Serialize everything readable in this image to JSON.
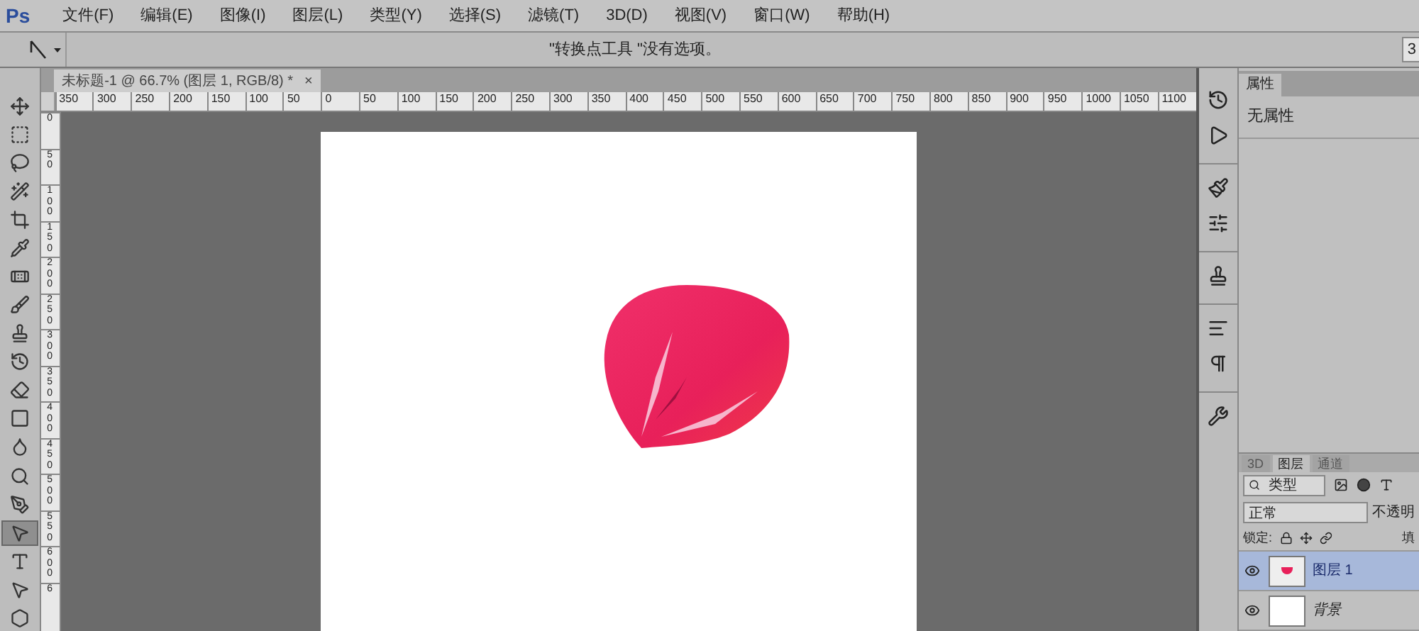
{
  "app": {
    "logo": "Ps"
  },
  "menu": [
    "文件(F)",
    "编辑(E)",
    "图像(I)",
    "图层(L)",
    "类型(Y)",
    "选择(S)",
    "滤镜(T)",
    "3D(D)",
    "视图(V)",
    "窗口(W)",
    "帮助(H)"
  ],
  "options_bar": {
    "tool_hint": "\"转换点工具 \"没有选项。",
    "workspace": "3"
  },
  "tools": [
    {
      "selected": false
    },
    {
      "selected": false
    },
    {
      "selected": false
    },
    {
      "selected": false
    },
    {
      "selected": false
    },
    {
      "selected": false
    },
    {
      "selected": false
    },
    {
      "selected": false
    },
    {
      "selected": false
    },
    {
      "selected": false
    },
    {
      "selected": false
    },
    {
      "selected": false
    },
    {
      "selected": false
    },
    {
      "selected": false
    },
    {
      "selected": false
    },
    {
      "selected": true
    },
    {
      "selected": false
    },
    {
      "selected": false
    },
    {
      "selected": false
    }
  ],
  "document": {
    "tab_title": "未标题-1 @ 66.7% (图层 1, RGB/8) *",
    "close": "×",
    "ruler_h": [
      "350",
      "300",
      "250",
      "200",
      "150",
      "100",
      "50",
      "0",
      "50",
      "100",
      "150",
      "200",
      "250",
      "300",
      "350",
      "400",
      "450",
      "500",
      "550",
      "600",
      "650",
      "700",
      "750",
      "800",
      "850",
      "900",
      "950",
      "1000",
      "1050",
      "1100"
    ],
    "ruler_v": [
      "0",
      "50",
      "100",
      "150",
      "200",
      "250",
      "300",
      "350",
      "400",
      "450",
      "500",
      "550",
      "600",
      "6"
    ]
  },
  "properties": {
    "tab": "属性",
    "content": "无属性"
  },
  "layers_panel": {
    "tabs": [
      {
        "label": "3D",
        "selected": false
      },
      {
        "label": "图层",
        "selected": true
      },
      {
        "label": "通道",
        "selected": false
      }
    ],
    "filter": "类型",
    "blend_mode": "正常",
    "opacity_label": "不透明",
    "lock_label": "锁定:",
    "fill_label": "填",
    "layers": [
      {
        "name": "图层 1",
        "kind": "layer",
        "selected": true,
        "visible": true
      },
      {
        "name": "背景",
        "kind": "background",
        "selected": false,
        "visible": true
      }
    ]
  }
}
